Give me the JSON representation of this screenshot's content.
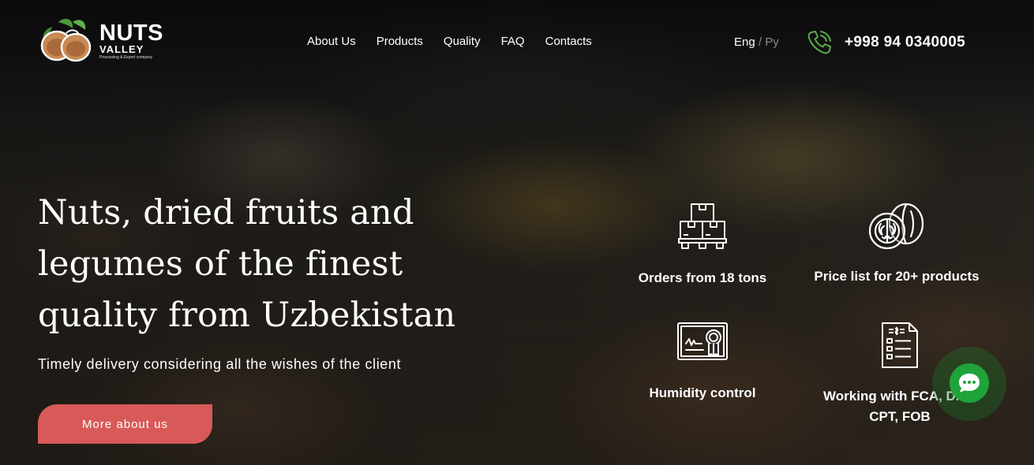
{
  "brand": {
    "name": "NUTS",
    "sub": "VALLEY",
    "tagline": "Processing & Export company"
  },
  "nav": {
    "items": [
      {
        "label": "About Us"
      },
      {
        "label": "Products"
      },
      {
        "label": "Quality"
      },
      {
        "label": "FAQ"
      },
      {
        "label": "Contacts"
      }
    ]
  },
  "language": {
    "active": "Eng",
    "separator": "/",
    "inactive": "Ру"
  },
  "contact": {
    "phone": "+998 94 0340005",
    "icon": "phone-icon",
    "icon_color": "#5aa94a"
  },
  "hero": {
    "headline_lines": [
      "Nuts, dried fruits and",
      "legumes of the finest",
      "quality from Uzbekistan"
    ],
    "subline": "Timely delivery considering all the wishes of the client",
    "cta_label": "More about us",
    "cta_color": "#d85a58"
  },
  "features": [
    {
      "icon": "boxes-pallet-icon",
      "label": "Orders from 18 tons"
    },
    {
      "icon": "walnut-icon",
      "label": "Price list for 20+ products"
    },
    {
      "icon": "certificate-icon",
      "label": "Humidity control"
    },
    {
      "icon": "invoice-icon",
      "label_lines": [
        "Working with FCA, DAP,",
        "CPT, FOB"
      ]
    }
  ],
  "chat": {
    "icon": "chat-bubble-icon",
    "color": "#1fa33a"
  }
}
